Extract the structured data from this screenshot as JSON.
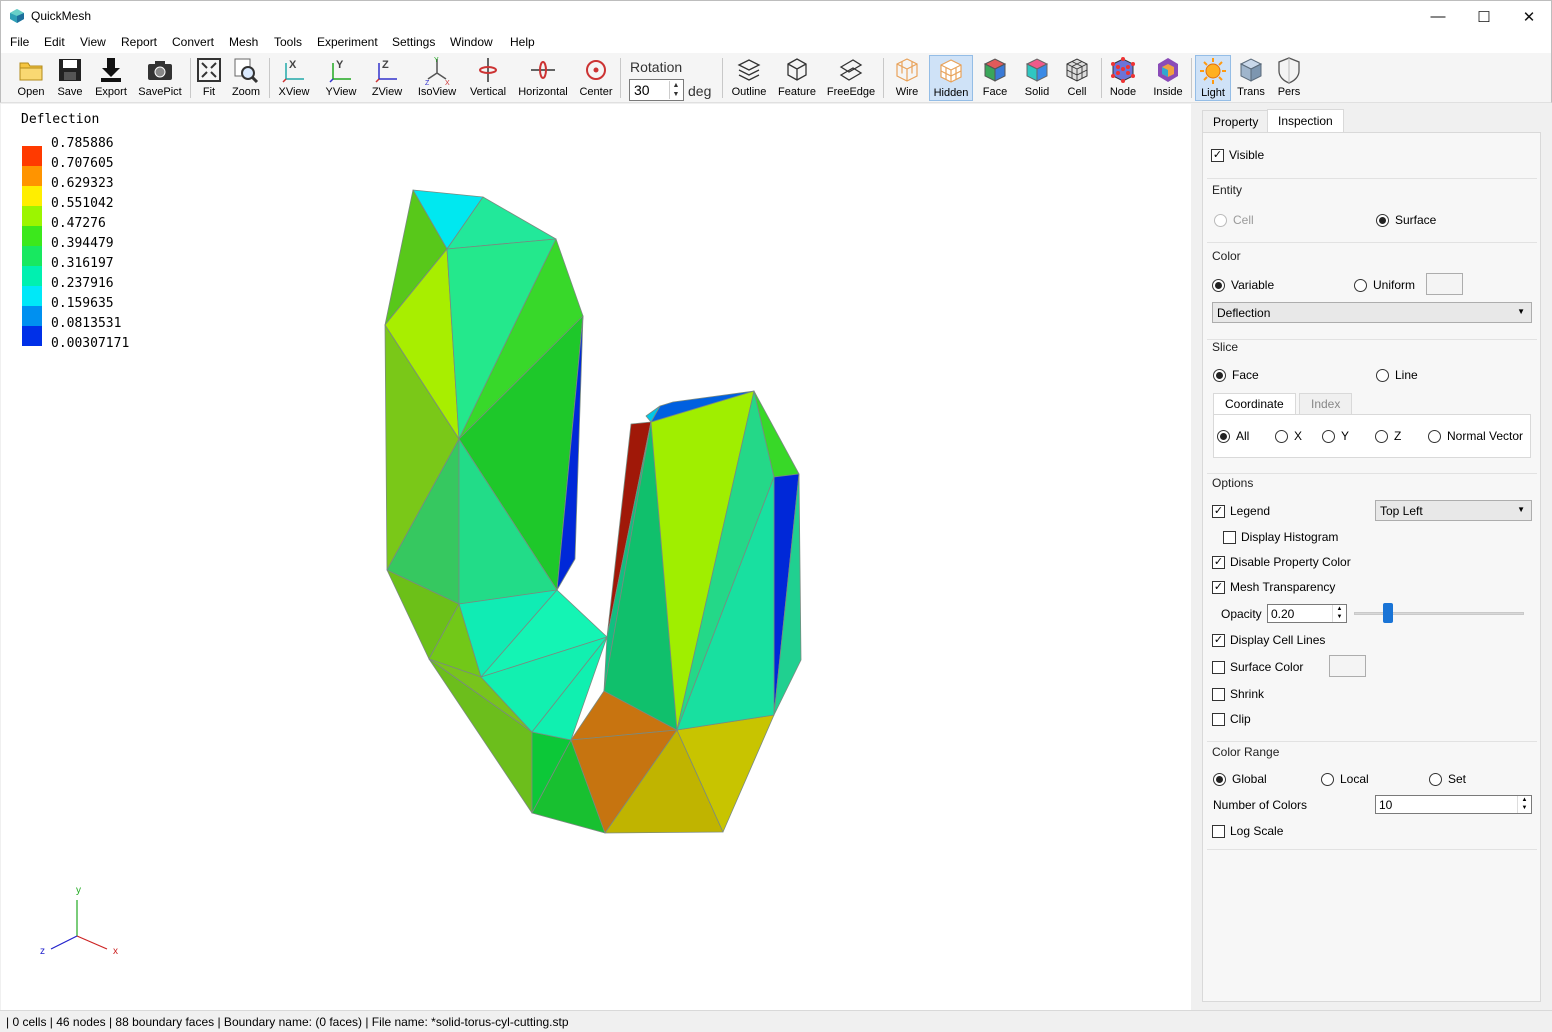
{
  "window": {
    "title": "QuickMesh",
    "min_label": "—",
    "max_label": "☐",
    "close_label": "✕"
  },
  "menu": [
    "File",
    "Edit",
    "View",
    "Report",
    "Convert",
    "Mesh",
    "Tools",
    "Experiment",
    "Settings",
    "Window",
    "Help"
  ],
  "toolbar": {
    "buttons": [
      {
        "label": "Open",
        "icon": "folder-icon"
      },
      {
        "label": "Save",
        "icon": "floppy-icon"
      },
      {
        "label": "Export",
        "icon": "download-icon"
      },
      {
        "label": "SavePict",
        "icon": "camera-icon"
      },
      {
        "label": "Fit",
        "icon": "fit-icon"
      },
      {
        "label": "Zoom",
        "icon": "zoom-icon"
      },
      {
        "label": "XView",
        "icon": "xview-icon"
      },
      {
        "label": "YView",
        "icon": "yview-icon"
      },
      {
        "label": "ZView",
        "icon": "zview-icon"
      },
      {
        "label": "IsoView",
        "icon": "isoview-icon"
      },
      {
        "label": "Vertical",
        "icon": "vertical-rotate-icon"
      },
      {
        "label": "Horizontal",
        "icon": "horizontal-rotate-icon"
      },
      {
        "label": "Center",
        "icon": "center-icon"
      },
      {
        "label": "Outline",
        "icon": "outline-icon"
      },
      {
        "label": "Feature",
        "icon": "feature-icon"
      },
      {
        "label": "FreeEdge",
        "icon": "freeedge-icon"
      },
      {
        "label": "Wire",
        "icon": "wire-icon"
      },
      {
        "label": "Hidden",
        "icon": "hidden-icon"
      },
      {
        "label": "Face",
        "icon": "face-icon"
      },
      {
        "label": "Solid",
        "icon": "solid-icon"
      },
      {
        "label": "Cell",
        "icon": "cell-icon"
      },
      {
        "label": "Node",
        "icon": "node-icon"
      },
      {
        "label": "Inside",
        "icon": "inside-icon"
      },
      {
        "label": "Light",
        "icon": "light-icon"
      },
      {
        "label": "Trans",
        "icon": "trans-icon"
      },
      {
        "label": "Pers",
        "icon": "pers-icon"
      }
    ],
    "rotation_label": "Rotation",
    "rotation_value": "30",
    "rotation_unit": "deg",
    "active": [
      "Hidden",
      "Light"
    ]
  },
  "legend": {
    "title": "Deflection",
    "entries": [
      {
        "value": "0.785886",
        "color": "#ff3300"
      },
      {
        "value": "0.707605",
        "color": "#ff9900"
      },
      {
        "value": "0.629323",
        "color": "#ffff00"
      },
      {
        "value": "0.551042",
        "color": "#99ff00"
      },
      {
        "value": "0.47276",
        "color": "#33ff00"
      },
      {
        "value": "0.394479",
        "color": "#00ff33"
      },
      {
        "value": "0.316197",
        "color": "#00ffaa"
      },
      {
        "value": "0.237916",
        "color": "#00ffff"
      },
      {
        "value": "0.159635",
        "color": "#0099ff"
      },
      {
        "value": "0.0813531",
        "color": "#0033ff"
      },
      {
        "value": "0.00307171",
        "color": "#0000ff"
      }
    ]
  },
  "axes": {
    "x": "x",
    "y": "y",
    "z": "z"
  },
  "panel": {
    "tabs": [
      "Property",
      "Inspection"
    ],
    "active_tab": "Inspection",
    "visible_label": "Visible",
    "entity": {
      "title": "Entity",
      "cell": "Cell",
      "surface": "Surface"
    },
    "color": {
      "title": "Color",
      "variable": "Variable",
      "uniform": "Uniform",
      "variable_select": "Deflection"
    },
    "slice": {
      "title": "Slice",
      "face": "Face",
      "line": "Line",
      "subtabs": [
        "Coordinate",
        "Index"
      ],
      "all": "All",
      "x": "X",
      "y": "Y",
      "z": "Z",
      "normal": "Normal Vector"
    },
    "options": {
      "title": "Options",
      "legend": "Legend",
      "legend_position": "Top Left",
      "display_histogram": "Display Histogram",
      "disable_property_color": "Disable Property Color",
      "mesh_transparency": "Mesh Transparency",
      "opacity_label": "Opacity",
      "opacity_value": "0.20",
      "opacity_fraction": 0.2,
      "display_cell_lines": "Display Cell Lines",
      "surface_color": "Surface Color",
      "shrink": "Shrink",
      "clip": "Clip"
    },
    "color_range": {
      "title": "Color Range",
      "global": "Global",
      "local": "Local",
      "set": "Set",
      "num_colors_label": "Number of Colors",
      "num_colors_value": "10",
      "log_scale": "Log Scale"
    }
  },
  "status": "| 0 cells | 46 nodes | 88 boundary faces |  Boundary name:  (0 faces) | File name: *solid-torus-cyl-cutting.stp"
}
